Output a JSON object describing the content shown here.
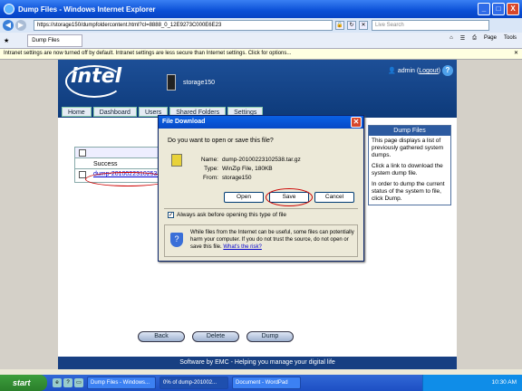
{
  "window": {
    "title": "Dump Files - Windows Internet Explorer",
    "close": "X",
    "minimize": "_",
    "maximize": "□"
  },
  "browser": {
    "url": "https://storage150/dumpfoldercontent.html?cl=8888_0_12E9273C000E6E23",
    "search_placeholder": "Live Search",
    "tab_label": "Dump Files",
    "page_menu": "Page",
    "tools_menu": "Tools",
    "infobar": "Intranet settings are now turned off by default. Intranet settings are less secure than Internet settings. Click for options..."
  },
  "app": {
    "logo": "intel",
    "hostname": "storage150",
    "admin_text": "admin",
    "logout": "Logout",
    "nav": [
      "Home",
      "Dashboard",
      "Users",
      "Shared Folders",
      "Settings"
    ],
    "table": {
      "status": "Success",
      "dump_link": "dump-20100223102538"
    },
    "sidebar": {
      "title": "Dump Files",
      "p1": "This page displays a list of previously gathered system dumps.",
      "p2": "Click a link to download the system dump file.",
      "p3": "In order to dump the current status of the system to file, click Dump."
    },
    "buttons": {
      "back": "Back",
      "delete": "Delete",
      "dump": "Dump"
    },
    "footer": "Software by EMC - Helping you manage your digital life"
  },
  "dialog": {
    "title": "File Download",
    "question": "Do you want to open or save this file?",
    "name_label": "Name:",
    "name_value": "dump-20100223102538.tar.gz",
    "type_label": "Type:",
    "type_value": "WinZip File, 180KB",
    "from_label": "From:",
    "from_value": "storage150",
    "open": "Open",
    "save": "Save",
    "cancel": "Cancel",
    "always_ask": "Always ask before opening this type of file",
    "warning": "While files from the Internet can be useful, some files can potentially harm your computer. If you do not trust the source, do not open or save this file.",
    "risk_link": "What's the risk?"
  },
  "taskbar": {
    "start": "start",
    "items": [
      "Dump Files - Windows...",
      "0% of dump-201002...",
      "Document - WordPad"
    ],
    "clock": "10:30 AM"
  }
}
